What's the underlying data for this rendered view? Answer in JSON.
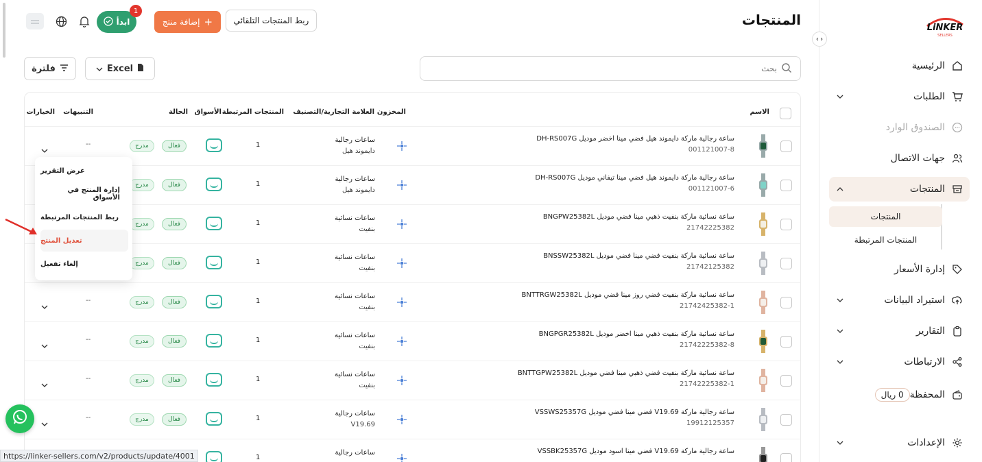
{
  "brand": {
    "logo_text": "LiNKER",
    "logo_sub": "SELLERS"
  },
  "sidebar": {
    "items": [
      {
        "label": "الرئيسية",
        "icon": "home-icon"
      },
      {
        "label": "الطلبات",
        "icon": "cart-icon"
      },
      {
        "label": "الصندوق الوارد",
        "icon": "chat-icon"
      },
      {
        "label": "جهات الاتصال",
        "icon": "users-icon"
      },
      {
        "label": "المنتجات",
        "icon": "box-icon"
      },
      {
        "label": "إدارة الأسعار",
        "icon": "tag-icon"
      },
      {
        "label": "استيراد البيانات",
        "icon": "upload-icon"
      },
      {
        "label": "التقارير",
        "icon": "clipboard-icon"
      },
      {
        "label": "الارتباطات",
        "icon": "share-icon"
      },
      {
        "label": "المحفظة",
        "icon": "wallet-icon",
        "badge": "0 ريال"
      },
      {
        "label": "الإعدادات",
        "icon": "gear-icon"
      }
    ],
    "sub_items": [
      "المنتجات",
      "المنتجات المرتبطة"
    ]
  },
  "header": {
    "title": "المنتجات",
    "auto_link_label": "ربط المنتجات التلقائي",
    "add_product_label": "إضافة منتج",
    "start_label": "ابدأ",
    "start_badge": "1"
  },
  "toolbar": {
    "search_placeholder": "بحث",
    "excel_label": "Excel",
    "filter_label": "فلترة"
  },
  "table": {
    "headers": {
      "name": "الاسم",
      "stock": "المخزون",
      "brand": "العلامة التجارية/التصنيف",
      "linked": "المنتجات المرتبطة",
      "markets": "الأسواق",
      "status": "الحالة",
      "alerts": "التنبيهات",
      "options": "الخيارات"
    },
    "rows": [
      {
        "name": "ساعة رجالية ماركة دايموند هيل فضي مينا اخضر موديل DH-RS007G",
        "sku": "001121007-8",
        "category": "ساعات رجالية",
        "brand": "دايموند هيل",
        "linked": "1",
        "status": "فعال",
        "listed": "مدرج",
        "alerts": "--",
        "watch": "green"
      },
      {
        "name": "ساعة رجالية ماركة دايموند هيل فضي مينا تيفاني موديل DH-RS007G",
        "sku": "001121007-6",
        "category": "ساعات رجالية",
        "brand": "دايموند هيل",
        "linked": "1",
        "status": "فعال",
        "listed": "مدرج",
        "alerts": "--",
        "watch": "tiffany"
      },
      {
        "name": "ساعة نسائية ماركة بنفيت ذهبي مينا فضي موديل BNGPW25382L",
        "sku": "21742225382",
        "category": "ساعات نسائية",
        "brand": "بنفيت",
        "linked": "1",
        "status": "فعال",
        "listed": "مدرج",
        "alerts": "--",
        "watch": "gold"
      },
      {
        "name": "ساعة نسائية ماركة بنفيت فضي مينا فضي موديل BNSSW25382L",
        "sku": "21742125382",
        "category": "ساعات نسائية",
        "brand": "بنفيت",
        "linked": "1",
        "status": "فعال",
        "listed": "مدرج",
        "alerts": "--",
        "watch": "silver"
      },
      {
        "name": "ساعة نسائية ماركة بنفيت فضي روز مينا فضي موديل BNTTRGW25382L",
        "sku": "21742425382-1",
        "category": "ساعات نسائية",
        "brand": "بنفيت",
        "linked": "1",
        "status": "فعال",
        "listed": "مدرج",
        "alerts": "--",
        "watch": "rose"
      },
      {
        "name": "ساعة نسائية ماركة بنفيت ذهبي مينا اخضر موديل BNGPGR25382L",
        "sku": "21742225382-8",
        "category": "ساعات نسائية",
        "brand": "بنفيت",
        "linked": "1",
        "status": "فعال",
        "listed": "مدرج",
        "alerts": "--",
        "watch": "goldgreen"
      },
      {
        "name": "ساعة نسائية ماركة بنفيت فضي ذهبي مينا فضي موديل BNTTGPW25382L",
        "sku": "21742225382-1",
        "category": "ساعات نسائية",
        "brand": "بنفيت",
        "linked": "1",
        "status": "فعال",
        "listed": "مدرج",
        "alerts": "--",
        "watch": "rose"
      },
      {
        "name": "ساعة رجالية ماركة V19.69 فضي مينا فضي موديل VSSWS25357G",
        "sku": "19912125357",
        "category": "ساعات رجالية",
        "brand": "V19.69",
        "linked": "1",
        "status": "فعال",
        "listed": "مدرج",
        "alerts": "--",
        "watch": "silver"
      },
      {
        "name": "ساعة رجالية ماركة V19.69 فضي مينا اسود موديل VSSBK25357G",
        "sku": "",
        "category": "ساعات رجالية",
        "brand": "",
        "linked": "1",
        "status": "",
        "listed": "",
        "alerts": "",
        "watch": "black"
      }
    ]
  },
  "dropdown": {
    "items": [
      "عرض التقرير",
      "إدارة المنتج في الأسواق",
      "ربط المنتجات المرتبطة",
      "تعديل المنتج",
      "إلغاء تفعيل"
    ],
    "highlighted_index": 3
  },
  "status_url": "https://linker-sellers.com/v2/products/update/4001",
  "colors": {
    "accent": "#f07846",
    "green": "#2f9f6f",
    "active_bg": "#f7efe9",
    "danger": "#e2352c"
  }
}
